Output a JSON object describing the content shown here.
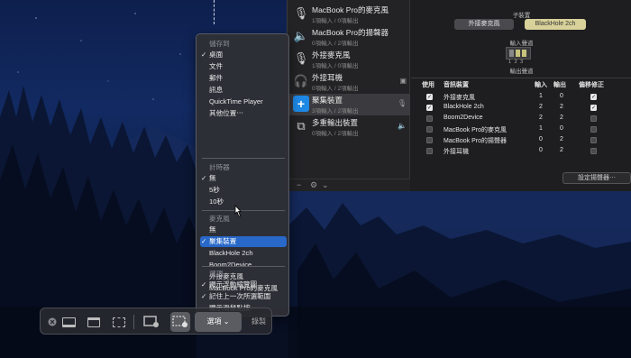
{
  "audio_midi": {
    "devices": [
      {
        "name": "MacBook Pro的麥克風",
        "sub": "1項輸入 / 0項輸出",
        "icon": "mic-icon",
        "right": ""
      },
      {
        "name": "MacBook Pro的揚聲器",
        "sub": "0項輸入 / 2項輸出",
        "icon": "speaker-icon",
        "right": ""
      },
      {
        "name": "外接麥克風",
        "sub": "1項輸入 / 0項輸出",
        "icon": "mic-icon",
        "right": ""
      },
      {
        "name": "外接耳機",
        "sub": "0項輸入 / 2項輸出",
        "icon": "headphones-icon",
        "right": "▣"
      },
      {
        "name": "聚集裝置",
        "sub": "3項輸入 / 2項輸出",
        "icon": "aggregate-icon",
        "right": "🎙"
      },
      {
        "name": "多重輸出裝置",
        "sub": "0項輸入 / 2項輸出",
        "icon": "multi-output-icon",
        "right": "🔈"
      }
    ],
    "subdevice_label": "子裝置",
    "chip_a": "外接麥克風",
    "chip_b": "BlackHole 2ch",
    "input_stream_label": "輸入聲道",
    "stream_numbers": "1 2 3",
    "output_stream_label": "輸出聲道",
    "table_headers": {
      "use": "使用",
      "device": "音訊裝置",
      "in": "輸入",
      "out": "輸出",
      "drift": "偏移修正"
    },
    "table_rows": [
      {
        "name": "外接麥克風",
        "in": "1",
        "out": "0",
        "use": true,
        "drift": true
      },
      {
        "name": "BlackHole 2ch",
        "in": "2",
        "out": "2",
        "use": true,
        "drift": true
      },
      {
        "name": "Boom2Device",
        "in": "2",
        "out": "2",
        "use": false,
        "drift": false
      },
      {
        "name": "MacBook Pro的麥克風",
        "in": "1",
        "out": "0",
        "use": false,
        "drift": false
      },
      {
        "name": "MacBook Pro的揚聲器",
        "in": "0",
        "out": "2",
        "use": false,
        "drift": false
      },
      {
        "name": "外接耳機",
        "in": "0",
        "out": "2",
        "use": false,
        "drift": false
      }
    ],
    "configure_speakers": "設定揚聲器⋯",
    "footer_icons": [
      "−",
      "⚙",
      "⌄"
    ]
  },
  "menu": {
    "save_header": "儲存到",
    "save_items": [
      {
        "label": "桌面",
        "checked": true
      },
      {
        "label": "文件",
        "checked": false
      },
      {
        "label": "郵件",
        "checked": false
      },
      {
        "label": "訊息",
        "checked": false
      },
      {
        "label": "QuickTime Player",
        "checked": false
      },
      {
        "label": "其他位置⋯",
        "checked": false
      }
    ],
    "timer_header": "計時器",
    "timer_items": [
      {
        "label": "無",
        "checked": true
      },
      {
        "label": "5秒",
        "checked": false
      },
      {
        "label": "10秒",
        "checked": false
      }
    ],
    "mic_header": "麥克風",
    "mic_items": [
      {
        "label": "無",
        "checked": false,
        "highlighted": false
      },
      {
        "label": "聚集裝置",
        "checked": true,
        "highlighted": true
      },
      {
        "label": "BlackHole 2ch",
        "checked": false,
        "highlighted": false
      },
      {
        "label": "Boom2Device",
        "checked": false,
        "highlighted": false
      },
      {
        "label": "外接麥克風",
        "checked": false,
        "highlighted": false
      },
      {
        "label": "MacBook Pro的麥克風",
        "checked": false,
        "highlighted": false
      }
    ],
    "options_header": "選項",
    "options_items": [
      {
        "label": "顯示浮動縮覽圖",
        "checked": true
      },
      {
        "label": "記住上一次所選範圍",
        "checked": true
      },
      {
        "label": "顯示滑鼠點按",
        "checked": false
      }
    ]
  },
  "toolbar": {
    "options_label": "選項 ⌄",
    "record_label": "錄製"
  },
  "colors": {
    "highlight": "#2868c8",
    "aggregate_icon": "#1e88e5",
    "chip_selected": "#d8d29a"
  }
}
